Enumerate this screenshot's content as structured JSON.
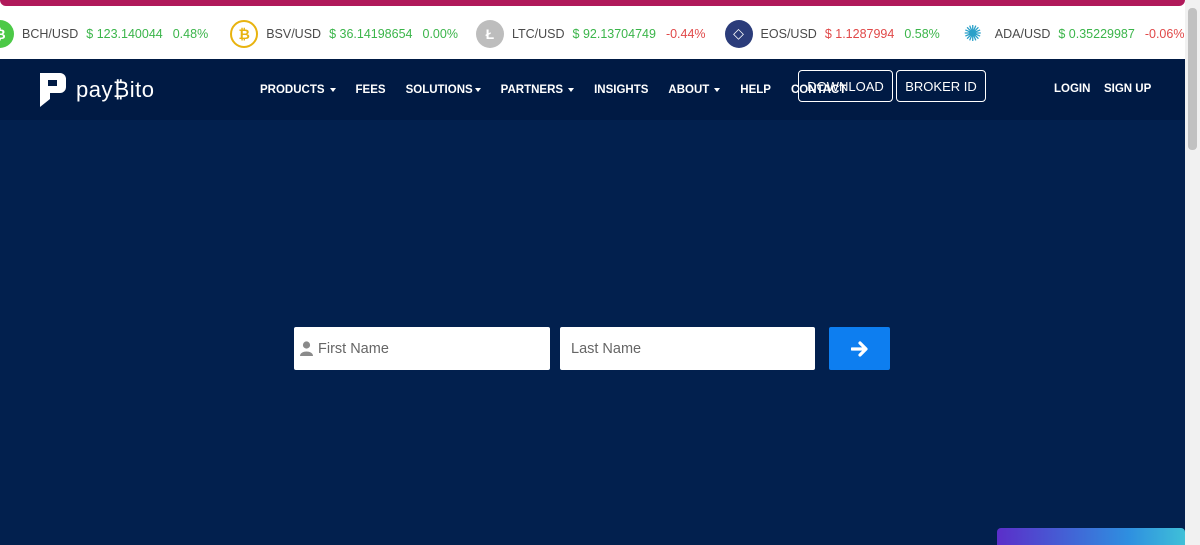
{
  "ticker": [
    {
      "pair": "BCH/USD",
      "price": "$ 123.140044",
      "change": "0.48%",
      "trend": "up",
      "icon": "bitcoin-cash-icon",
      "color": "#4cc947",
      "glyph": "₿"
    },
    {
      "pair": "BSV/USD",
      "price": "$ 36.14198654",
      "change": "0.00%",
      "trend": "up",
      "icon": "bitcoin-sv-icon",
      "color": "#e8b30f",
      "glyph": "₿"
    },
    {
      "pair": "LTC/USD",
      "price": "$ 92.13704749",
      "change": "-0.44%",
      "trend": "down",
      "icon": "litecoin-icon",
      "color": "#bdbdbd",
      "glyph": "Ł"
    },
    {
      "pair": "EOS/USD",
      "price": "$ 1.1287994",
      "change": "0.58%",
      "trend": "down",
      "icon": "eos-icon",
      "color": "#2b3c7a",
      "glyph": "◇"
    },
    {
      "pair": "ADA/USD",
      "price": "$ 0.35229987",
      "change": "-0.06%",
      "trend": "down",
      "icon": "cardano-icon",
      "color": "#2aa0c9",
      "glyph": "✺"
    }
  ],
  "brand": {
    "name": "pay₿ito"
  },
  "nav": {
    "products": "PRODUCTS",
    "fees": "FEES",
    "solutions": "SOLUTIONS",
    "partners": "PARTNERS",
    "insights": "INSIGHTS",
    "about": "ABOUT",
    "help": "HELP",
    "contact": "CONTACT",
    "download": "DOWNLOAD",
    "broker_id": "BROKER ID",
    "login": "LOGIN",
    "signup": "SIGN UP"
  },
  "form": {
    "first_name_placeholder": "First Name",
    "last_name_placeholder": "Last Name",
    "first_name_value": "",
    "last_name_value": ""
  },
  "colors": {
    "hero_bg": "#02204e",
    "nav_bg": "#001a44",
    "accent": "#0d7ef0",
    "up": "#3bb54a",
    "down": "#e04848"
  }
}
